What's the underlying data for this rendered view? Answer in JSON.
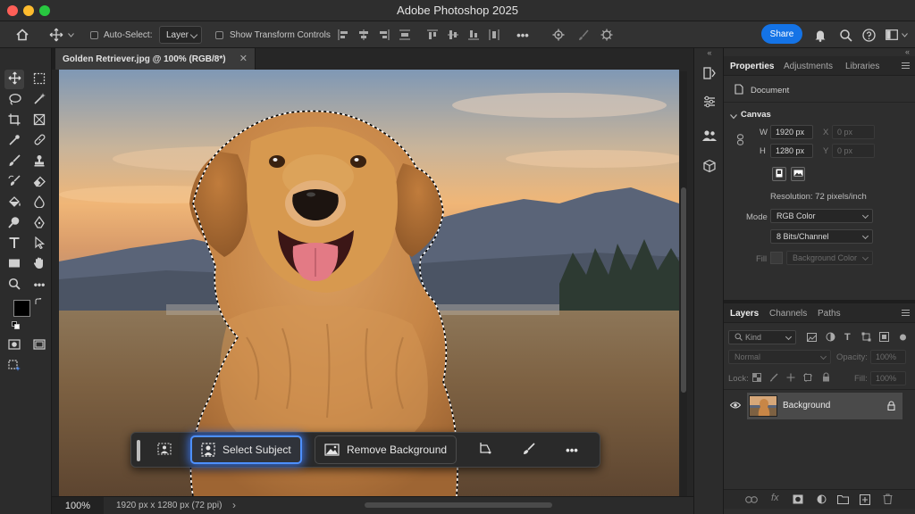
{
  "window": {
    "title": "Adobe Photoshop 2025",
    "traffic_colors": [
      "#ff5f57",
      "#febc2e",
      "#28c840"
    ]
  },
  "options_bar": {
    "auto_select_label": "Auto-Select:",
    "auto_select_value": "Layer",
    "show_transform_label": "Show Transform Controls",
    "more_label": "•••",
    "share_label": "Share"
  },
  "document": {
    "tab_title": "Golden Retriever.jpg @ 100% (RGB/8*)",
    "close_glyph": "✕",
    "zoom": "100%",
    "size_info": "1920 px x 1280 px (72 ppi)",
    "status_arrow": "›"
  },
  "contextual_bar": {
    "select_subject": "Select Subject",
    "remove_background": "Remove Background",
    "more": "•••",
    "accent": "#4d90ff"
  },
  "collapse_glyph": "«",
  "properties": {
    "tabs": [
      "Properties",
      "Adjustments",
      "Libraries"
    ],
    "document_label": "Document",
    "canvas_heading": "Canvas",
    "w_label": "W",
    "w_value": "1920 px",
    "h_label": "H",
    "h_value": "1280 px",
    "x_label": "X",
    "x_value": "0 px",
    "y_label": "Y",
    "y_value": "0 px",
    "resolution": "Resolution: 72 pixels/inch",
    "mode_label": "Mode",
    "mode_value": "RGB Color",
    "bits_value": "8 Bits/Channel",
    "fill_label": "Fill",
    "fill_value": "Background Color"
  },
  "layers": {
    "tabs": [
      "Layers",
      "Channels",
      "Paths"
    ],
    "filter_placeholder": "Kind",
    "blend_mode": "Normal",
    "opacity_label": "Opacity:",
    "opacity_value": "100%",
    "lock_label": "Lock:",
    "fill_label": "Fill:",
    "fill_value": "100%",
    "layer_name": "Background"
  }
}
